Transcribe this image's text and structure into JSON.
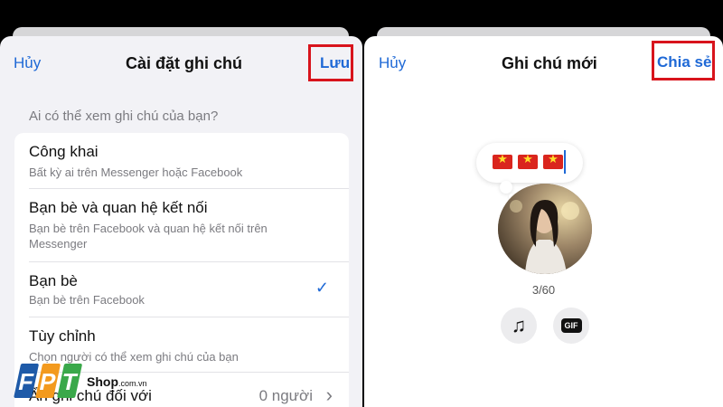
{
  "left": {
    "cancel_label": "Hủy",
    "title": "Cài đặt ghi chú",
    "save_label": "Lưu",
    "section_label": "Ai có thể xem ghi chú của bạn?",
    "options": [
      {
        "title": "Công khai",
        "desc": "Bất kỳ ai trên Messenger hoặc Facebook"
      },
      {
        "title": "Bạn bè và quan hệ kết nối",
        "desc": "Bạn bè trên Facebook và quan hệ kết nối trên Messenger"
      },
      {
        "title": "Bạn bè",
        "desc": "Bạn bè trên Facebook",
        "selected": true
      },
      {
        "title": "Tùy chỉnh",
        "desc": "Chọn người có thể xem ghi chú của bạn"
      }
    ],
    "hide_row": {
      "title": "Ẩn ghi chú đối với",
      "value": "0 người"
    }
  },
  "right": {
    "cancel_label": "Hủy",
    "title": "Ghi chú mới",
    "share_label": "Chia sẻ",
    "note_content": "🇻🇳🇻🇳🇻🇳",
    "counter": "3/60",
    "buttons": [
      "music-icon",
      "gif-icon"
    ],
    "gif_label": "GIF"
  },
  "watermark": {
    "brand": "FPT",
    "shop": "Shop",
    "domain": ".com.vn"
  },
  "colors": {
    "accent": "#1f69d6",
    "highlight": "#d8141c"
  }
}
